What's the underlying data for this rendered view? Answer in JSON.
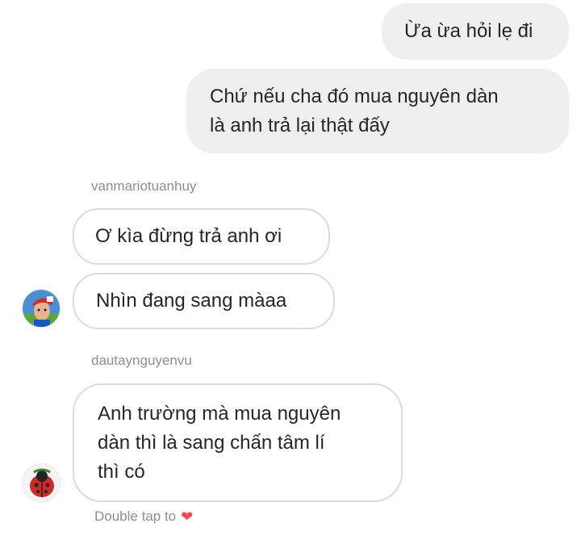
{
  "thread": {
    "outgoing": [
      {
        "lines": [
          "Ừa ừa hỏi lẹ đi"
        ]
      },
      {
        "lines": [
          "Chứ nếu cha đó mua nguyên dàn",
          "là anh trả lại thật đấy"
        ]
      }
    ],
    "groups": [
      {
        "sender": "vanmariotuanhuy",
        "avatar_icon": "mario-avatar",
        "messages": [
          {
            "lines": [
              "Ơ kìa đừng trả anh ơi"
            ]
          },
          {
            "lines": [
              "Nhìn đang sang màaa"
            ]
          }
        ]
      },
      {
        "sender": "dautaynguyenvu",
        "avatar_icon": "ladybug-avatar",
        "messages": [
          {
            "lines": [
              "Anh trường mà mua nguyên",
              "dàn thì là sang chấn tâm lí",
              "thì có"
            ]
          }
        ]
      }
    ]
  },
  "footer": {
    "hint": "Double tap to",
    "heart_icon": "heart-icon",
    "heart_glyph": "❤",
    "heart_color": "#ed4956"
  },
  "colors": {
    "outgoing_bubble": "#efefef",
    "incoming_border": "#dbdbdb",
    "text": "#262626",
    "meta_text": "#8e8e8e"
  }
}
